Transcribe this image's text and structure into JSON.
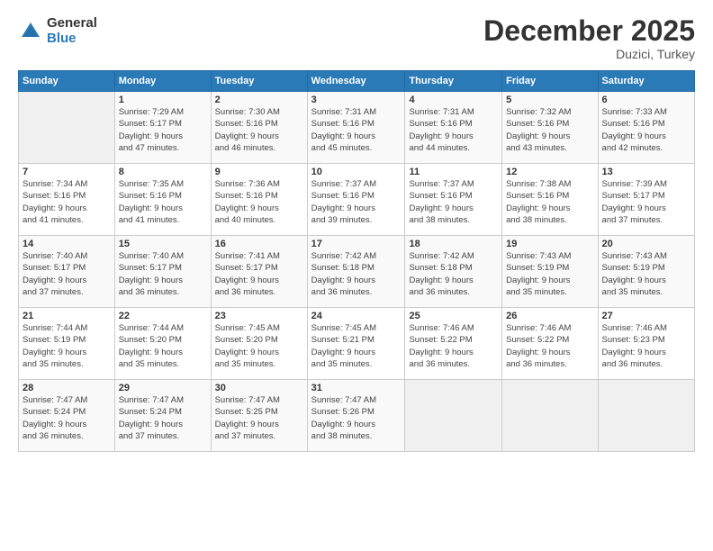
{
  "header": {
    "logo_general": "General",
    "logo_blue": "Blue",
    "month_title": "December 2025",
    "location": "Duzici, Turkey"
  },
  "weekdays": [
    "Sunday",
    "Monday",
    "Tuesday",
    "Wednesday",
    "Thursday",
    "Friday",
    "Saturday"
  ],
  "weeks": [
    [
      {
        "day": "",
        "info": ""
      },
      {
        "day": "1",
        "info": "Sunrise: 7:29 AM\nSunset: 5:17 PM\nDaylight: 9 hours\nand 47 minutes."
      },
      {
        "day": "2",
        "info": "Sunrise: 7:30 AM\nSunset: 5:16 PM\nDaylight: 9 hours\nand 46 minutes."
      },
      {
        "day": "3",
        "info": "Sunrise: 7:31 AM\nSunset: 5:16 PM\nDaylight: 9 hours\nand 45 minutes."
      },
      {
        "day": "4",
        "info": "Sunrise: 7:31 AM\nSunset: 5:16 PM\nDaylight: 9 hours\nand 44 minutes."
      },
      {
        "day": "5",
        "info": "Sunrise: 7:32 AM\nSunset: 5:16 PM\nDaylight: 9 hours\nand 43 minutes."
      },
      {
        "day": "6",
        "info": "Sunrise: 7:33 AM\nSunset: 5:16 PM\nDaylight: 9 hours\nand 42 minutes."
      }
    ],
    [
      {
        "day": "7",
        "info": "Sunrise: 7:34 AM\nSunset: 5:16 PM\nDaylight: 9 hours\nand 41 minutes."
      },
      {
        "day": "8",
        "info": "Sunrise: 7:35 AM\nSunset: 5:16 PM\nDaylight: 9 hours\nand 41 minutes."
      },
      {
        "day": "9",
        "info": "Sunrise: 7:36 AM\nSunset: 5:16 PM\nDaylight: 9 hours\nand 40 minutes."
      },
      {
        "day": "10",
        "info": "Sunrise: 7:37 AM\nSunset: 5:16 PM\nDaylight: 9 hours\nand 39 minutes."
      },
      {
        "day": "11",
        "info": "Sunrise: 7:37 AM\nSunset: 5:16 PM\nDaylight: 9 hours\nand 38 minutes."
      },
      {
        "day": "12",
        "info": "Sunrise: 7:38 AM\nSunset: 5:16 PM\nDaylight: 9 hours\nand 38 minutes."
      },
      {
        "day": "13",
        "info": "Sunrise: 7:39 AM\nSunset: 5:17 PM\nDaylight: 9 hours\nand 37 minutes."
      }
    ],
    [
      {
        "day": "14",
        "info": "Sunrise: 7:40 AM\nSunset: 5:17 PM\nDaylight: 9 hours\nand 37 minutes."
      },
      {
        "day": "15",
        "info": "Sunrise: 7:40 AM\nSunset: 5:17 PM\nDaylight: 9 hours\nand 36 minutes."
      },
      {
        "day": "16",
        "info": "Sunrise: 7:41 AM\nSunset: 5:17 PM\nDaylight: 9 hours\nand 36 minutes."
      },
      {
        "day": "17",
        "info": "Sunrise: 7:42 AM\nSunset: 5:18 PM\nDaylight: 9 hours\nand 36 minutes."
      },
      {
        "day": "18",
        "info": "Sunrise: 7:42 AM\nSunset: 5:18 PM\nDaylight: 9 hours\nand 36 minutes."
      },
      {
        "day": "19",
        "info": "Sunrise: 7:43 AM\nSunset: 5:19 PM\nDaylight: 9 hours\nand 35 minutes."
      },
      {
        "day": "20",
        "info": "Sunrise: 7:43 AM\nSunset: 5:19 PM\nDaylight: 9 hours\nand 35 minutes."
      }
    ],
    [
      {
        "day": "21",
        "info": "Sunrise: 7:44 AM\nSunset: 5:19 PM\nDaylight: 9 hours\nand 35 minutes."
      },
      {
        "day": "22",
        "info": "Sunrise: 7:44 AM\nSunset: 5:20 PM\nDaylight: 9 hours\nand 35 minutes."
      },
      {
        "day": "23",
        "info": "Sunrise: 7:45 AM\nSunset: 5:20 PM\nDaylight: 9 hours\nand 35 minutes."
      },
      {
        "day": "24",
        "info": "Sunrise: 7:45 AM\nSunset: 5:21 PM\nDaylight: 9 hours\nand 35 minutes."
      },
      {
        "day": "25",
        "info": "Sunrise: 7:46 AM\nSunset: 5:22 PM\nDaylight: 9 hours\nand 36 minutes."
      },
      {
        "day": "26",
        "info": "Sunrise: 7:46 AM\nSunset: 5:22 PM\nDaylight: 9 hours\nand 36 minutes."
      },
      {
        "day": "27",
        "info": "Sunrise: 7:46 AM\nSunset: 5:23 PM\nDaylight: 9 hours\nand 36 minutes."
      }
    ],
    [
      {
        "day": "28",
        "info": "Sunrise: 7:47 AM\nSunset: 5:24 PM\nDaylight: 9 hours\nand 36 minutes."
      },
      {
        "day": "29",
        "info": "Sunrise: 7:47 AM\nSunset: 5:24 PM\nDaylight: 9 hours\nand 37 minutes."
      },
      {
        "day": "30",
        "info": "Sunrise: 7:47 AM\nSunset: 5:25 PM\nDaylight: 9 hours\nand 37 minutes."
      },
      {
        "day": "31",
        "info": "Sunrise: 7:47 AM\nSunset: 5:26 PM\nDaylight: 9 hours\nand 38 minutes."
      },
      {
        "day": "",
        "info": ""
      },
      {
        "day": "",
        "info": ""
      },
      {
        "day": "",
        "info": ""
      }
    ]
  ]
}
